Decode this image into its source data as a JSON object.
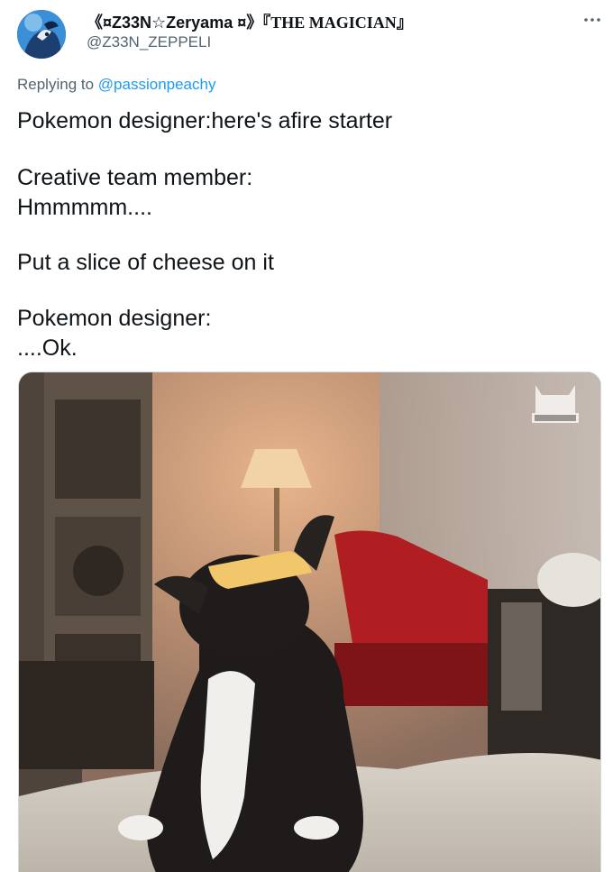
{
  "tweet": {
    "author": {
      "display_name_prefix": "《¤Z33N☆Zeryama ¤》",
      "display_name_suffix": "『THE MAGICIAN』",
      "handle": "@Z33N_ZEPPELI",
      "avatar_icon": "character-avatar"
    },
    "more_icon": "more-horizontal-icon",
    "reply_prefix": "Replying to",
    "reply_mention": "@passionpeachy",
    "body_lines": [
      "Pokemon designer:here's afire starter",
      "Creative team member:",
      "Hmmmmm....",
      "Put a slice of cheese on it",
      "Pokemon designer:",
      "....Ok."
    ],
    "media": {
      "description_icon": "cat-with-cheese-photo",
      "watermark_icon": "cat-watermark-logo"
    }
  },
  "colors": {
    "text": "#0f1419",
    "secondary": "#536471",
    "link": "#1d9bf0",
    "border": "#cfd9de"
  }
}
